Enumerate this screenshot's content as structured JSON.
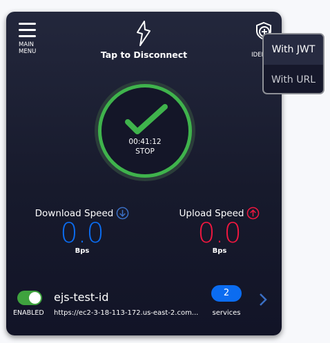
{
  "header": {
    "main_menu_line1": "MAIN",
    "main_menu_line2": "MENU",
    "connect_label": "Tap to Disconnect",
    "add_identity_line1": "ADD",
    "add_identity_line2": "IDENTITY"
  },
  "status": {
    "timer": "00:41:12",
    "stop_label": "STOP",
    "connected": true,
    "ring_color": "#3fb34c"
  },
  "download": {
    "label": "Download Speed",
    "value": "0.0",
    "unit": "Bps",
    "color": "#0b6cf0"
  },
  "upload": {
    "label": "Upload Speed",
    "value": "0.0",
    "unit": "Bps",
    "color": "#f0173f"
  },
  "identity": {
    "enabled_label": "ENABLED",
    "enabled": true,
    "name": "ejs-test-id",
    "url": "https://ec2-3-18-113-172.us-east-2.com...",
    "services_count": "2",
    "services_label": "services"
  },
  "dropdown": {
    "items": [
      {
        "label": "With JWT",
        "highlighted": true
      },
      {
        "label": "With URL",
        "highlighted": false
      }
    ]
  }
}
